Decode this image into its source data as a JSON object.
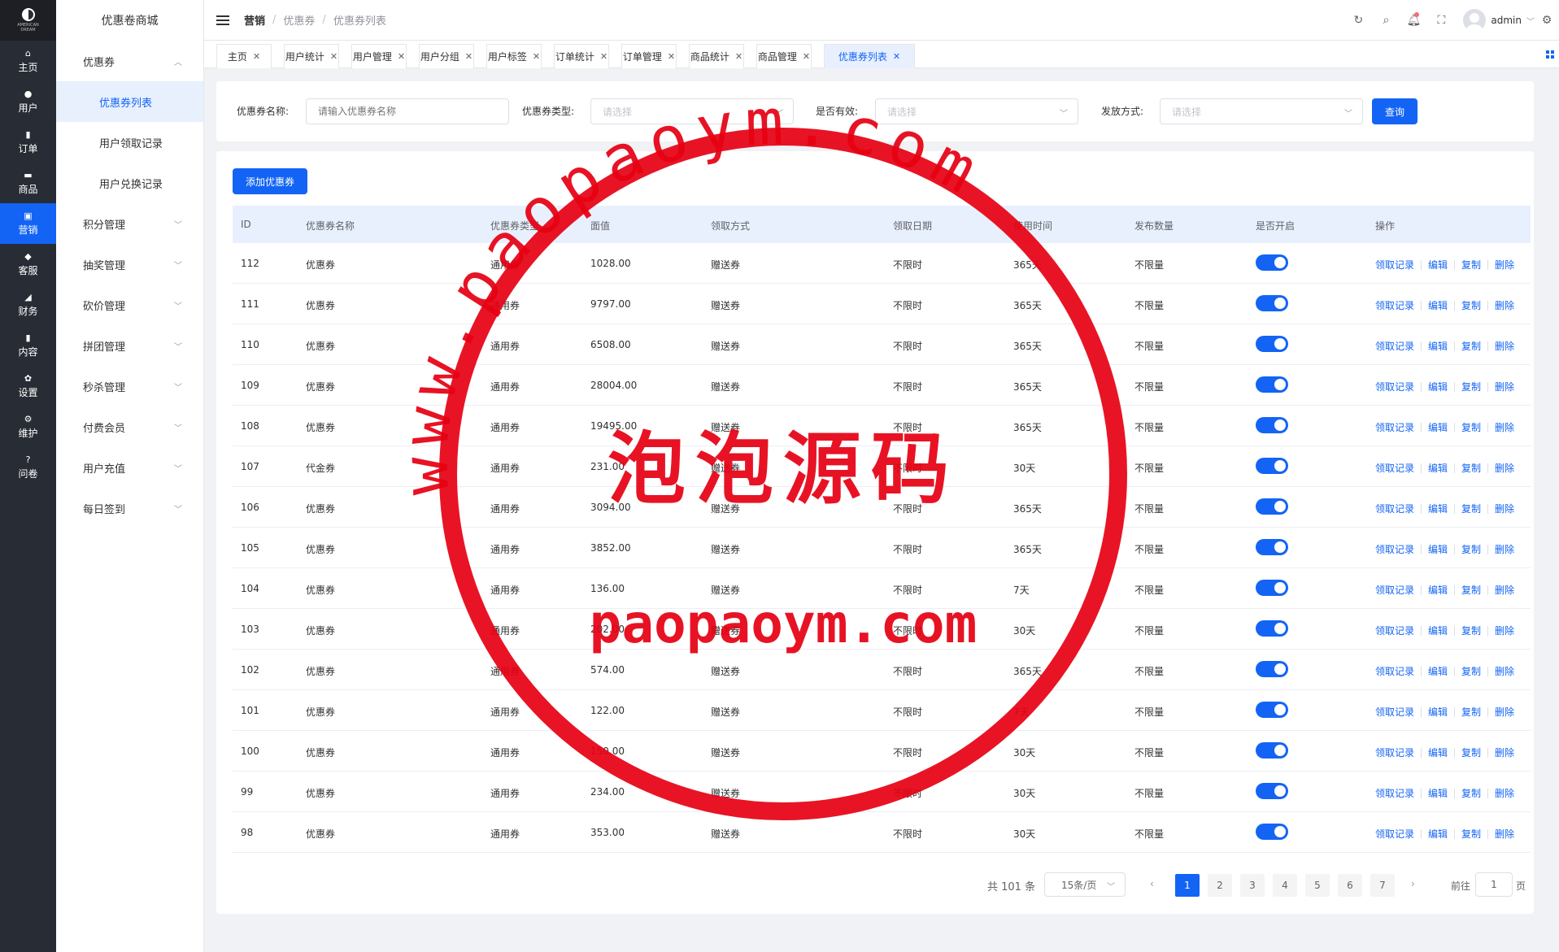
{
  "rail": {
    "logo_text": "AMERICAN DREAM",
    "items": [
      {
        "label": "主页",
        "icon": "home-icon",
        "glyph": "⌂"
      },
      {
        "label": "用户",
        "icon": "user-icon",
        "glyph": "●"
      },
      {
        "label": "订单",
        "icon": "order-icon",
        "glyph": "▮"
      },
      {
        "label": "商品",
        "icon": "goods-icon",
        "glyph": "▬"
      },
      {
        "label": "营销",
        "icon": "marketing-icon",
        "glyph": "▣"
      },
      {
        "label": "客服",
        "icon": "service-icon",
        "glyph": "◆"
      },
      {
        "label": "财务",
        "icon": "finance-icon",
        "glyph": "◢"
      },
      {
        "label": "内容",
        "icon": "content-icon",
        "glyph": "▮"
      },
      {
        "label": "设置",
        "icon": "settings-icon",
        "glyph": "✿"
      },
      {
        "label": "维护",
        "icon": "maintain-icon",
        "glyph": "⚙"
      },
      {
        "label": "问卷",
        "icon": "question-icon",
        "glyph": "?"
      }
    ]
  },
  "sidebar": {
    "title": "优惠卷商城",
    "coupon_group": "优惠券",
    "sub_items": [
      "优惠券列表",
      "用户领取记录",
      "用户兑换记录"
    ],
    "groups": [
      "积分管理",
      "抽奖管理",
      "砍价管理",
      "拼团管理",
      "秒杀管理",
      "付费会员",
      "用户充值",
      "每日签到"
    ]
  },
  "header": {
    "breadcrumb": [
      "营销",
      "优惠券",
      "优惠券列表"
    ],
    "user": "admin"
  },
  "tabs": [
    "主页",
    "用户统计",
    "用户管理",
    "用户分组",
    "用户标签",
    "订单统计",
    "订单管理",
    "商品统计",
    "商品管理",
    "优惠券列表"
  ],
  "filters": {
    "name_label": "优惠券名称:",
    "name_placeholder": "请输入优惠券名称",
    "type_label": "优惠券类型:",
    "valid_label": "是否有效:",
    "method_label": "发放方式:",
    "select_placeholder": "请选择",
    "query_button": "查询"
  },
  "table": {
    "add_button": "添加优惠券",
    "columns": [
      "ID",
      "优惠券名称",
      "优惠券类型",
      "面值",
      "领取方式",
      "领取日期",
      "使用时间",
      "发布数量",
      "是否开启",
      "操作"
    ],
    "actions": [
      "领取记录",
      "编辑",
      "复制",
      "删除"
    ],
    "rows": [
      {
        "id": "112",
        "name": "优惠券",
        "type": "通用券",
        "value": "1028.00",
        "method": "赠送券",
        "date": "不限时",
        "use": "365天",
        "qty": "不限量",
        "enabled": true
      },
      {
        "id": "111",
        "name": "优惠券",
        "type": "通用券",
        "value": "9797.00",
        "method": "赠送券",
        "date": "不限时",
        "use": "365天",
        "qty": "不限量",
        "enabled": true
      },
      {
        "id": "110",
        "name": "优惠券",
        "type": "通用券",
        "value": "6508.00",
        "method": "赠送券",
        "date": "不限时",
        "use": "365天",
        "qty": "不限量",
        "enabled": true
      },
      {
        "id": "109",
        "name": "优惠券",
        "type": "通用券",
        "value": "28004.00",
        "method": "赠送券",
        "date": "不限时",
        "use": "365天",
        "qty": "不限量",
        "enabled": true
      },
      {
        "id": "108",
        "name": "优惠券",
        "type": "通用券",
        "value": "19495.00",
        "method": "赠送券",
        "date": "不限时",
        "use": "365天",
        "qty": "不限量",
        "enabled": true
      },
      {
        "id": "107",
        "name": "代金券",
        "type": "通用券",
        "value": "231.00",
        "method": "赠送券",
        "date": "不限时",
        "use": "30天",
        "qty": "不限量",
        "enabled": true
      },
      {
        "id": "106",
        "name": "优惠券",
        "type": "通用券",
        "value": "3094.00",
        "method": "赠送券",
        "date": "不限时",
        "use": "365天",
        "qty": "不限量",
        "enabled": true
      },
      {
        "id": "105",
        "name": "优惠券",
        "type": "通用券",
        "value": "3852.00",
        "method": "赠送券",
        "date": "不限时",
        "use": "365天",
        "qty": "不限量",
        "enabled": true
      },
      {
        "id": "104",
        "name": "优惠券",
        "type": "通用券",
        "value": "136.00",
        "method": "赠送券",
        "date": "不限时",
        "use": "7天",
        "qty": "不限量",
        "enabled": true
      },
      {
        "id": "103",
        "name": "优惠券",
        "type": "通用券",
        "value": "202.00",
        "method": "赠送券",
        "date": "不限时",
        "use": "30天",
        "qty": "不限量",
        "enabled": true
      },
      {
        "id": "102",
        "name": "优惠券",
        "type": "通用券",
        "value": "574.00",
        "method": "赠送券",
        "date": "不限时",
        "use": "365天",
        "qty": "不限量",
        "enabled": true
      },
      {
        "id": "101",
        "name": "优惠券",
        "type": "通用券",
        "value": "122.00",
        "method": "赠送券",
        "date": "不限时",
        "use": "7天",
        "qty": "不限量",
        "enabled": true
      },
      {
        "id": "100",
        "name": "优惠券",
        "type": "通用券",
        "value": "150.00",
        "method": "赠送券",
        "date": "不限时",
        "use": "30天",
        "qty": "不限量",
        "enabled": true
      },
      {
        "id": "99",
        "name": "优惠券",
        "type": "通用券",
        "value": "234.00",
        "method": "赠送券",
        "date": "不限时",
        "use": "30天",
        "qty": "不限量",
        "enabled": true
      },
      {
        "id": "98",
        "name": "优惠券",
        "type": "通用券",
        "value": "353.00",
        "method": "赠送券",
        "date": "不限时",
        "use": "30天",
        "qty": "不限量",
        "enabled": true
      }
    ]
  },
  "pagination": {
    "total": "共 101 条",
    "page_size": "15条/页",
    "pages": [
      "1",
      "2",
      "3",
      "4",
      "5",
      "6",
      "7"
    ],
    "current": "1",
    "goto_label": "前往",
    "goto_value": "1",
    "page_suffix": "页"
  },
  "watermark": {
    "ring_text": "www.paopaoym.com",
    "center_text": "泡泡源码",
    "bottom_text": "paopaoym.com",
    "color": "#e60012"
  },
  "colors": {
    "primary": "#1364f5",
    "rail_bg": "#282c34"
  }
}
